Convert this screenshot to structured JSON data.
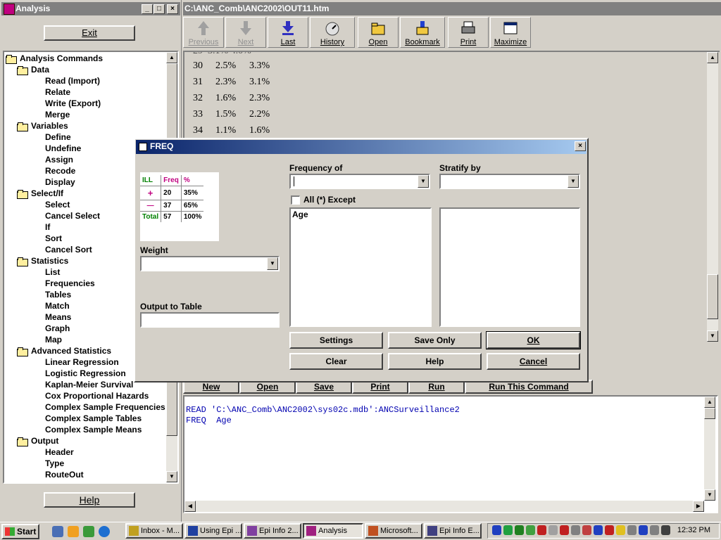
{
  "left_window": {
    "title": "Analysis",
    "exit_label": "Exit",
    "help_label": "Help",
    "tree": [
      {
        "label": "Analysis Commands",
        "level": 0,
        "folder": true
      },
      {
        "label": "Data",
        "level": 1,
        "folder": true
      },
      {
        "label": "Read (Import)",
        "level": 2
      },
      {
        "label": "Relate",
        "level": 2
      },
      {
        "label": "Write (Export)",
        "level": 2
      },
      {
        "label": "Merge",
        "level": 2
      },
      {
        "label": "Variables",
        "level": 1,
        "folder": true
      },
      {
        "label": "Define",
        "level": 2
      },
      {
        "label": "Undefine",
        "level": 2
      },
      {
        "label": "Assign",
        "level": 2
      },
      {
        "label": "Recode",
        "level": 2
      },
      {
        "label": "Display",
        "level": 2
      },
      {
        "label": "Select/If",
        "level": 1,
        "folder": true
      },
      {
        "label": "Select",
        "level": 2
      },
      {
        "label": "Cancel Select",
        "level": 2
      },
      {
        "label": "If",
        "level": 2
      },
      {
        "label": "Sort",
        "level": 2
      },
      {
        "label": "Cancel Sort",
        "level": 2
      },
      {
        "label": "Statistics",
        "level": 1,
        "folder": true
      },
      {
        "label": "List",
        "level": 2
      },
      {
        "label": "Frequencies",
        "level": 2
      },
      {
        "label": "Tables",
        "level": 2
      },
      {
        "label": "Match",
        "level": 2
      },
      {
        "label": "Means",
        "level": 2
      },
      {
        "label": "Graph",
        "level": 2
      },
      {
        "label": "Map",
        "level": 2
      },
      {
        "label": "Advanced Statistics",
        "level": 1,
        "folder": true
      },
      {
        "label": "Linear Regression",
        "level": 2
      },
      {
        "label": "Logistic Regression",
        "level": 2
      },
      {
        "label": "Kaplan-Meier Survival",
        "level": 2
      },
      {
        "label": "Cox Proportional Hazards",
        "level": 2
      },
      {
        "label": "Complex Sample Frequencies",
        "level": 2
      },
      {
        "label": "Complex Sample Tables",
        "level": 2
      },
      {
        "label": "Complex Sample Means",
        "level": 2
      },
      {
        "label": "Output",
        "level": 1,
        "folder": true
      },
      {
        "label": "Header",
        "level": 2
      },
      {
        "label": "Type",
        "level": 2
      },
      {
        "label": "RouteOut",
        "level": 2
      }
    ]
  },
  "browser": {
    "title": "C:\\ANC_Comb\\ANC2002\\OUT11.htm",
    "toolbar": [
      {
        "label": "Previous",
        "icon": "up-arrow-icon",
        "enabled": false
      },
      {
        "label": "Next",
        "icon": "down-arrow-icon",
        "enabled": false
      },
      {
        "label": "Last",
        "icon": "last-icon",
        "enabled": true
      },
      {
        "label": "History",
        "icon": "history-icon",
        "enabled": true
      },
      {
        "label": "Open",
        "icon": "open-folder-icon",
        "enabled": true
      },
      {
        "label": "Bookmark",
        "icon": "bookmark-icon",
        "enabled": true
      },
      {
        "label": "Print",
        "icon": "printer-icon",
        "enabled": true
      },
      {
        "label": "Maximize",
        "icon": "maximize-icon",
        "enabled": true
      }
    ],
    "rows": [
      {
        "value": "30",
        "pct": "2.5%",
        "cum": "3.3%"
      },
      {
        "value": "31",
        "pct": "2.3%",
        "cum": "3.1%"
      },
      {
        "value": "32",
        "pct": "1.6%",
        "cum": "2.3%"
      },
      {
        "value": "33",
        "pct": "1.5%",
        "cum": "2.2%"
      },
      {
        "value": "34",
        "pct": "1.1%",
        "cum": "1.6%"
      }
    ]
  },
  "program_editor": {
    "buttons": [
      "New",
      "Open",
      "Save",
      "Print",
      "Run",
      "Run This Command"
    ],
    "lines": [
      "READ 'C:\\ANC_Comb\\ANC2002\\sys02c.mdb':ANCSurveillance2",
      "FREQ  Age"
    ]
  },
  "freq_dialog": {
    "title": "FREQ",
    "sample_table": {
      "headers": [
        "ILL",
        "Freq",
        "%"
      ],
      "rows": [
        [
          "+",
          "20",
          "35%"
        ],
        [
          "—",
          "37",
          "65%"
        ],
        [
          "Total",
          "57",
          "100%"
        ]
      ]
    },
    "frequency_of_label": "Frequency of",
    "stratify_by_label": "Stratify by",
    "all_except_label": "All (*) Except",
    "weight_label": "Weight",
    "output_table_label": "Output to Table",
    "variables": [
      "Age"
    ],
    "buttons": {
      "settings": "Settings",
      "save_only": "Save Only",
      "ok": "OK",
      "clear": "Clear",
      "help": "Help",
      "cancel": "Cancel"
    }
  },
  "taskbar": {
    "start": "Start",
    "tasks": [
      "Inbox - M...",
      "Using Epi ...",
      "Epi Info 2...",
      "Analysis",
      "Microsoft...",
      "Epi Info E..."
    ],
    "clock": "12:32 PM"
  }
}
